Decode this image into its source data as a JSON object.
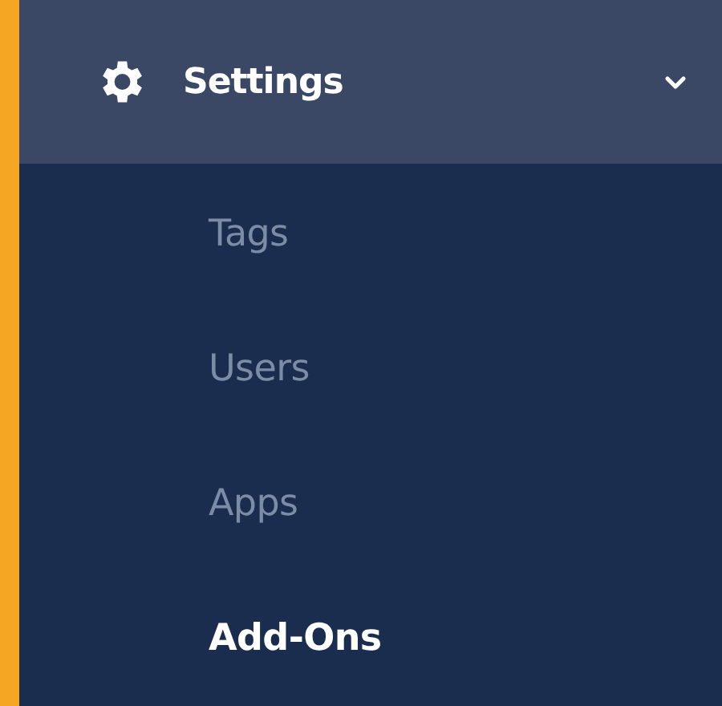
{
  "menu": {
    "label": "Settings",
    "expanded": true,
    "active": true,
    "children": [
      {
        "label": "Tags",
        "selected": false
      },
      {
        "label": "Users",
        "selected": false
      },
      {
        "label": "Apps",
        "selected": false
      },
      {
        "label": "Add-Ons",
        "selected": true
      }
    ]
  }
}
